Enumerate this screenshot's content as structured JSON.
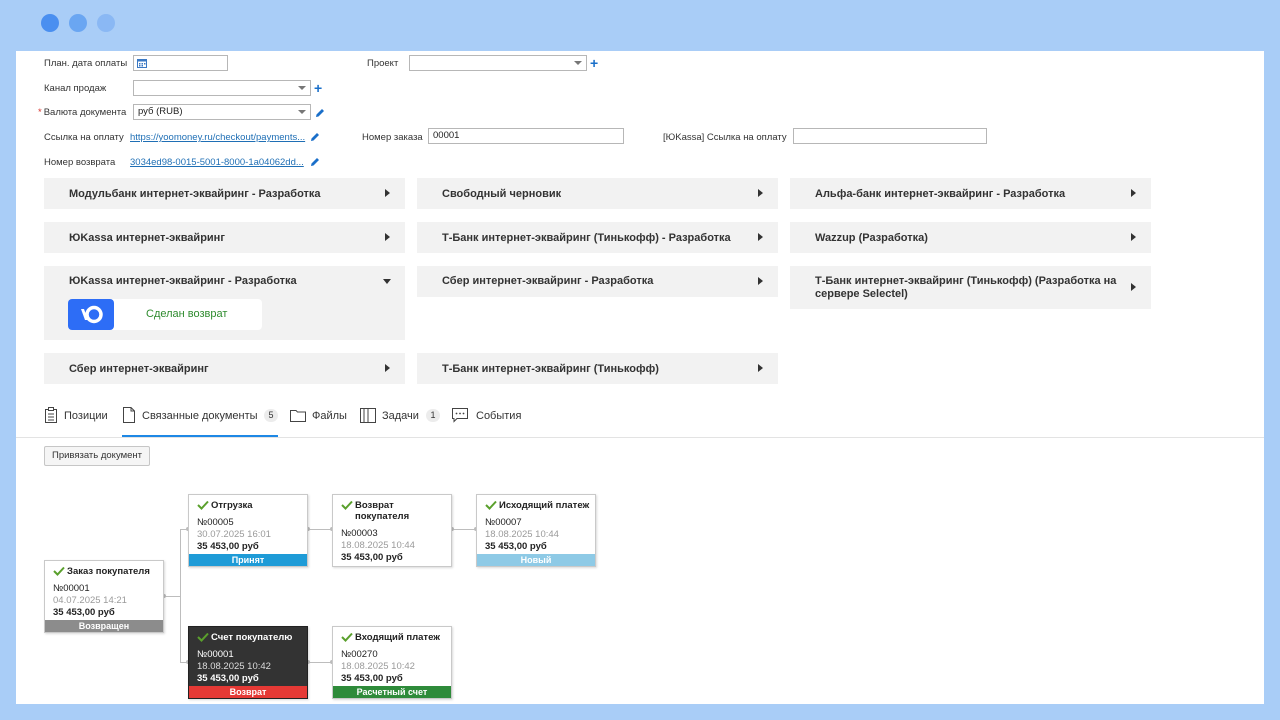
{
  "form": {
    "plan_date_label": "План. дата оплаты",
    "project_label": "Проект",
    "sales_channel_label": "Канал продаж",
    "currency_label": "Валюта документа",
    "currency_value": "руб (RUB)",
    "payment_link_label": "Ссылка на оплату",
    "payment_link_value": "https://yoomoney.ru/checkout/payments...",
    "order_number_label": "Номер заказа",
    "order_number_value": "00001",
    "yk_link_label": "[ЮKassa] Ссылка на оплату",
    "refund_number_label": "Номер возврата",
    "refund_number_value": "3034ed98-0015-5001-8000-1a04062dd..."
  },
  "payment_cards": [
    {
      "title": "Модульбанк интернет-эквайринг - Разработка"
    },
    {
      "title": "Свободный черновик"
    },
    {
      "title": "Альфа-банк интернет-эквайринг - Разработка"
    },
    {
      "title": "ЮKassa интернет-эквайринг"
    },
    {
      "title": "Т-Банк интернет-эквайринг (Тинькофф) - Разработка"
    },
    {
      "title": "Wazzup (Разработка)"
    },
    {
      "title": "ЮKassa интернет-эквайринг - Разработка",
      "status": "Сделан возврат"
    },
    {
      "title": "Сбер интернет-эквайринг - Разработка"
    },
    {
      "title": "Т-Банк интернет-эквайринг (Тинькофф) (Разработка на сервере Selectel)"
    },
    {
      "title": "Сбер интернет-эквайринг"
    },
    {
      "title": "Т-Банк интернет-эквайринг (Тинькофф)"
    }
  ],
  "tabs": [
    {
      "label": "Позиции"
    },
    {
      "label": "Связанные документы",
      "count": "5"
    },
    {
      "label": "Файлы"
    },
    {
      "label": "Задачи",
      "count": "1"
    },
    {
      "label": "События"
    }
  ],
  "attach_button": "Привязать документ",
  "docs": [
    {
      "title": "Заказ покупателя",
      "number": "№00001",
      "date": "04.07.2025 14:21",
      "amount": "35 453,00 руб",
      "status": "Возвращен",
      "status_color": "#8c8c8c"
    },
    {
      "title": "Отгрузка",
      "number": "№00005",
      "date": "30.07.2025 16:01",
      "amount": "35 453,00 руб",
      "status": "Принят",
      "status_color": "#1e9bd7"
    },
    {
      "title": "Возврат покупателя",
      "number": "№00003",
      "date": "18.08.2025 10:44",
      "amount": "35 453,00 руб",
      "status": "",
      "status_color": ""
    },
    {
      "title": "Исходящий платеж",
      "number": "№00007",
      "date": "18.08.2025 10:44",
      "amount": "35 453,00 руб",
      "status": "Новый",
      "status_color": "#8ecae6"
    },
    {
      "title": "Счет покупателю",
      "number": "№00001",
      "date": "18.08.2025 10:42",
      "amount": "35 453,00 руб",
      "status": "Возврат",
      "status_color": "#e53935"
    },
    {
      "title": "Входящий платеж",
      "number": "№00270",
      "date": "18.08.2025 10:42",
      "amount": "35 453,00 руб",
      "status": "Расчетный счет",
      "status_color": "#2e8b3a"
    }
  ],
  "colors": {
    "accent": "#1e88e5",
    "link": "#1f6fb5",
    "check": "#5aa02c"
  }
}
